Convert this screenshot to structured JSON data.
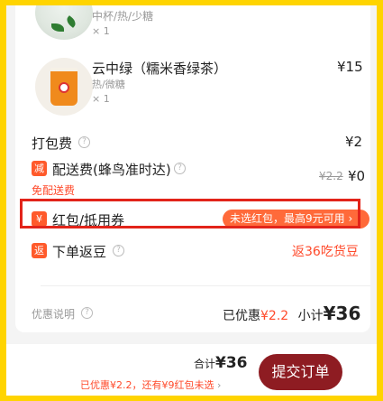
{
  "items": [
    {
      "spec": "中杯/热/少糖",
      "qty": "× 1"
    },
    {
      "name": "云中绿（糯米香绿茶）",
      "spec": "热/微糖",
      "qty": "× 1",
      "price": "¥15"
    }
  ],
  "packing": {
    "label": "打包费",
    "price": "¥2"
  },
  "delivery": {
    "badge": "减",
    "label": "配送费(蜂鸟准时达)",
    "original": "¥2.2",
    "price": "¥0",
    "note": "免配送费"
  },
  "redpacket": {
    "label": "红包/抵用券",
    "pill": "未选红包，最高9元可用"
  },
  "cashback": {
    "badge": "返",
    "label": "下单返豆",
    "value": "返36吃货豆"
  },
  "summary": {
    "discount_note": "优惠说明",
    "saved_label": "已优惠",
    "saved_value": "¥2.2",
    "subtotal_label": "小计",
    "subtotal_value": "¥36"
  },
  "footer": {
    "total_label": "合计",
    "total_value": "¥36",
    "saved_text": "已优惠¥2.2，还有¥9红包未选",
    "submit_label": "提交订单"
  },
  "colors": {
    "accent": "#ff4a2b",
    "submit": "#8e1c22",
    "border": "#ffd400"
  }
}
